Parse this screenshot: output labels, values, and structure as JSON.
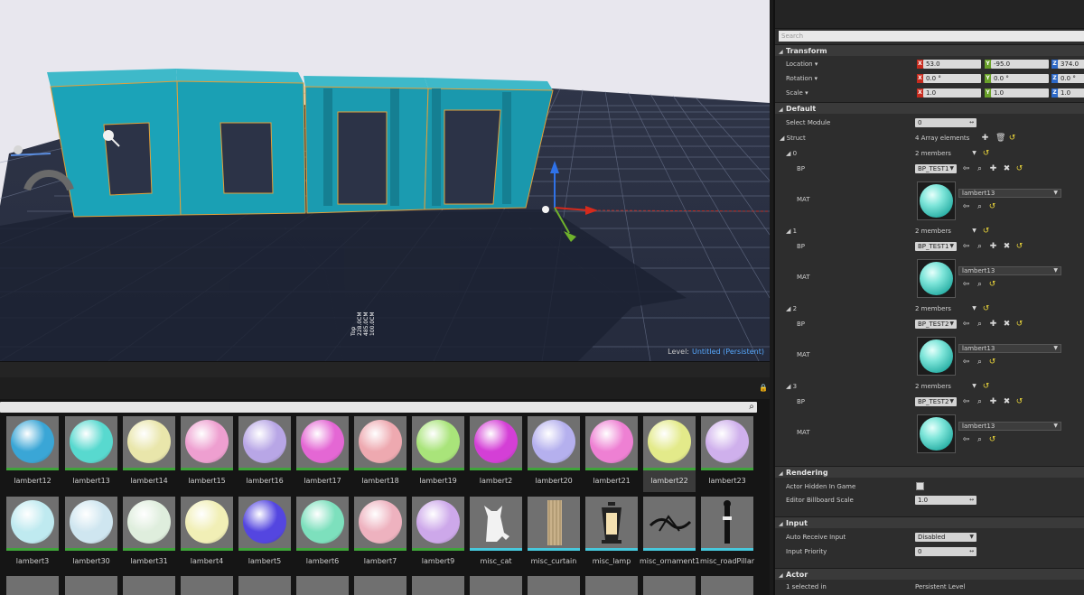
{
  "viewport": {
    "level_label": "Level:",
    "level_name": "Untitled (Persistent)",
    "measure_lines": [
      "Top",
      "228.0CM",
      "485.0CM",
      "100.0CM"
    ]
  },
  "details": {
    "search_placeholder": "Search",
    "transform": {
      "header": "Transform",
      "location_label": "Location",
      "rotation_label": "Rotation",
      "scale_label": "Scale",
      "location": {
        "x": "53.0",
        "y": "-95.0",
        "z": "374.0"
      },
      "rotation": {
        "x": "0.0 °",
        "y": "0.0 °",
        "z": "0.0 °"
      },
      "scale": {
        "x": "1.0",
        "y": "1.0",
        "z": "1.0"
      }
    },
    "default": {
      "header": "Default",
      "select_module_label": "Select Module",
      "select_module_value": "0",
      "struct_label": "Struct",
      "struct_value": "4 Array elements",
      "elements": [
        {
          "index": "0",
          "members": "2 members",
          "bp_label": "BP",
          "bp_value": "BP_TEST1",
          "mat_label": "MAT",
          "mat_value": "lambert13"
        },
        {
          "index": "1",
          "members": "2 members",
          "bp_label": "BP",
          "bp_value": "BP_TEST1",
          "mat_label": "MAT",
          "mat_value": "lambert13"
        },
        {
          "index": "2",
          "members": "2 members",
          "bp_label": "BP",
          "bp_value": "BP_TEST2",
          "mat_label": "MAT",
          "mat_value": "lambert13"
        },
        {
          "index": "3",
          "members": "2 members",
          "bp_label": "BP",
          "bp_value": "BP_TEST2",
          "mat_label": "MAT",
          "mat_value": "lambert13"
        }
      ]
    },
    "rendering": {
      "header": "Rendering",
      "hidden_label": "Actor Hidden In Game",
      "billboard_label": "Editor Billboard Scale",
      "billboard_value": "1.0"
    },
    "input": {
      "header": "Input",
      "receive_label": "Auto Receive Input",
      "receive_value": "Disabled",
      "priority_label": "Input Priority",
      "priority_value": "0"
    },
    "actor": {
      "header": "Actor",
      "selected_label": "1 selected in",
      "selected_value": "Persistent Level"
    }
  },
  "content_browser": {
    "row1": [
      {
        "name": "lambert12",
        "color": "#3aa6d6"
      },
      {
        "name": "lambert13",
        "color": "#58d9cf"
      },
      {
        "name": "lambert14",
        "color": "#e9e6ab"
      },
      {
        "name": "lambert15",
        "color": "#ee9fd0"
      },
      {
        "name": "lambert16",
        "color": "#b8a6e6"
      },
      {
        "name": "lambert17",
        "color": "#e467d4"
      },
      {
        "name": "lambert18",
        "color": "#eea9b0"
      },
      {
        "name": "lambert19",
        "color": "#a9e47a"
      },
      {
        "name": "lambert2",
        "color": "#d43fd6"
      },
      {
        "name": "lambert20",
        "color": "#b5b0ee"
      },
      {
        "name": "lambert21",
        "color": "#ee80d3"
      },
      {
        "name": "lambert22",
        "color": "#e3ea8a"
      },
      {
        "name": "lambert23",
        "color": "#cfb0ec"
      }
    ],
    "row2": [
      {
        "name": "lambert3",
        "color": "#bfeaf0",
        "kind": "sphere"
      },
      {
        "name": "lambert30",
        "color": "#cfe6f0",
        "kind": "sphere"
      },
      {
        "name": "lambert31",
        "color": "#dfeedd",
        "kind": "sphere"
      },
      {
        "name": "lambert4",
        "color": "#f1efb6",
        "kind": "sphere"
      },
      {
        "name": "lambert5",
        "color": "#5446e0",
        "kind": "sphere"
      },
      {
        "name": "lambert6",
        "color": "#7de0bd",
        "kind": "sphere"
      },
      {
        "name": "lambert7",
        "color": "#eeb2bf",
        "kind": "sphere"
      },
      {
        "name": "lambert9",
        "color": "#cda8ea",
        "kind": "sphere"
      },
      {
        "name": "misc_cat",
        "color": "#6fd8e6",
        "kind": "cat"
      },
      {
        "name": "misc_curtain",
        "color": "#6fd8e6",
        "kind": "curtain"
      },
      {
        "name": "misc_lamp",
        "color": "#6fd8e6",
        "kind": "lamp"
      },
      {
        "name": "misc_ornament1",
        "color": "#6fd8e6",
        "kind": "ornament"
      },
      {
        "name": "misc_roadPillar",
        "color": "#6fd8e6",
        "kind": "pillar"
      }
    ]
  }
}
